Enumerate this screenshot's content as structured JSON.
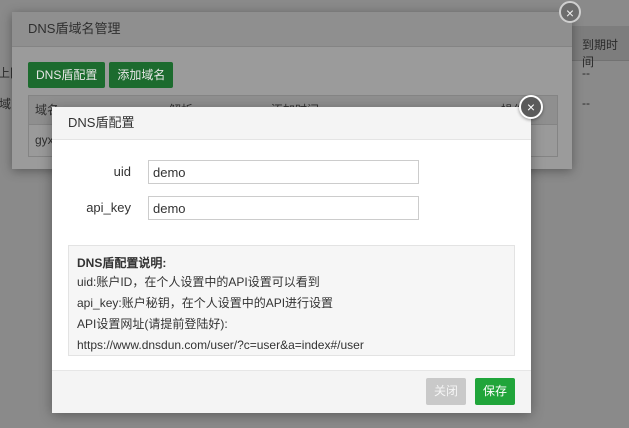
{
  "background": {
    "header_right": "到期时间",
    "row1_right": "--",
    "row2_right": "--",
    "left_text_1": "上同",
    "left_text_2": "域"
  },
  "outer_modal": {
    "title": "DNS盾域名管理",
    "close_symbol": "×",
    "buttons": {
      "dns_config": "DNS盾配置",
      "add_domain": "添加域名"
    },
    "table": {
      "headers": [
        "域名",
        "解析",
        "添加时间",
        "操作"
      ],
      "row1_col1": "gyx"
    }
  },
  "dialog": {
    "title": "DNS盾配置",
    "close_symbol": "×",
    "fields": {
      "uid_label": "uid",
      "uid_value": "demo",
      "api_key_label": "api_key",
      "api_key_value": "demo"
    },
    "help": {
      "title": "DNS盾配置说明:",
      "lines": [
        "uid:账户ID，在个人设置中的API设置可以看到",
        "api_key:账户秘钥，在个人设置中的API进行设置",
        "API设置网址(请提前登陆好):",
        "https://www.dnsdun.com/user/?c=user&a=index#/user"
      ]
    },
    "footer": {
      "close_label": "关闭",
      "save_label": "保存"
    }
  },
  "colors": {
    "accent_green": "#20a53a",
    "disabled_gray": "#c9c9c9"
  }
}
